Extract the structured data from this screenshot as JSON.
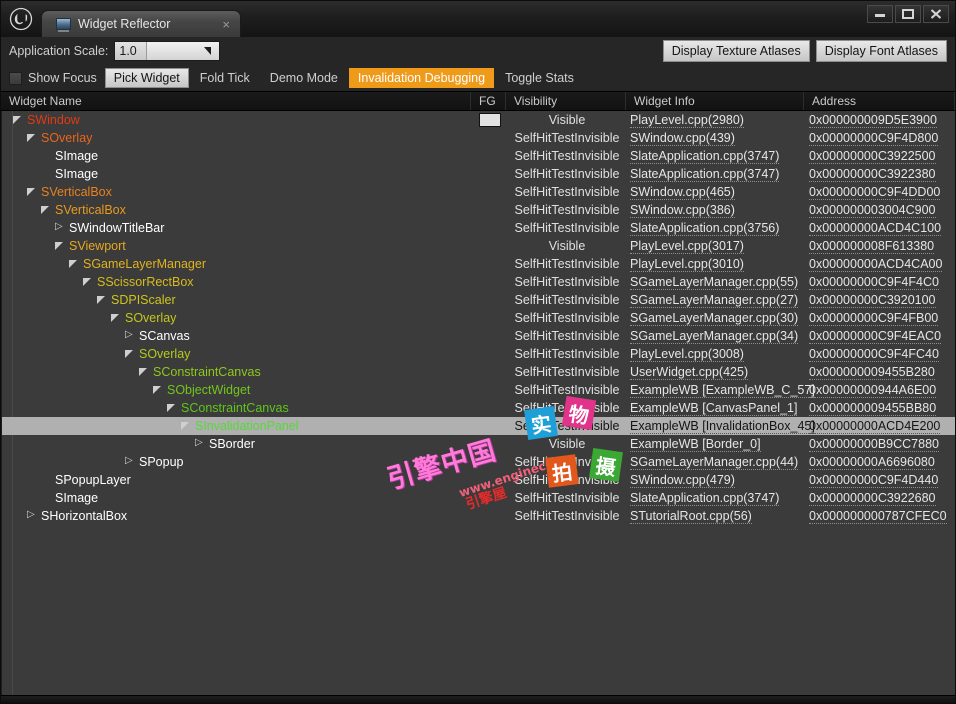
{
  "window": {
    "logo_glyph": "у",
    "controls": {
      "minimize": "minimize-icon",
      "maximize": "maximize-icon",
      "close": "close-icon"
    }
  },
  "tab": {
    "title": "Widget Reflector",
    "close_label": "×"
  },
  "toolbar": {
    "app_scale_label": "Application Scale:",
    "app_scale_value": "1.0",
    "display_texture_atlases": "Display Texture Atlases",
    "display_font_atlases": "Display Font Atlases",
    "show_focus": "Show Focus",
    "pick_widget": "Pick Widget",
    "fold_tick": "Fold Tick",
    "demo_mode": "Demo Mode",
    "invalidation_debugging": "Invalidation Debugging",
    "toggle_stats": "Toggle Stats",
    "accent_orange": "#f09a1a"
  },
  "columns": {
    "widget_name": "Widget Name",
    "fg": "FG",
    "visibility": "Visibility",
    "widget_info": "Widget Info",
    "address": "Address"
  },
  "watermark": {
    "main": "引擎中国",
    "url": "www.enginecn",
    "sub": "引擎屋",
    "stamps": [
      "实",
      "物",
      "拍",
      "摄"
    ]
  },
  "rows": [
    {
      "name": "SWindow",
      "depth": 0,
      "expander": "open",
      "color": "#e03a12",
      "fg": true,
      "visibility": "Visible",
      "info": "PlayLevel.cpp(2980)",
      "address": "0x000000009D5E3900",
      "selected": false
    },
    {
      "name": "SOverlay",
      "depth": 1,
      "expander": "open",
      "color": "#e8651f",
      "fg": false,
      "visibility": "SelfHitTestInvisible",
      "info": "SWindow.cpp(439)",
      "address": "0x00000000C9F4D800",
      "selected": false
    },
    {
      "name": "SImage",
      "depth": 2,
      "expander": "none",
      "color": "#ffffff",
      "fg": false,
      "visibility": "SelfHitTestInvisible",
      "info": "SlateApplication.cpp(3747)",
      "address": "0x00000000C3922500",
      "selected": false
    },
    {
      "name": "SImage",
      "depth": 2,
      "expander": "none",
      "color": "#ffffff",
      "fg": false,
      "visibility": "SelfHitTestInvisible",
      "info": "SlateApplication.cpp(3747)",
      "address": "0x00000000C3922380",
      "selected": false
    },
    {
      "name": "SVerticalBox",
      "depth": 1,
      "expander": "open",
      "color": "#e8821f",
      "fg": false,
      "visibility": "SelfHitTestInvisible",
      "info": "SWindow.cpp(465)",
      "address": "0x00000000C9F4DD00",
      "selected": false
    },
    {
      "name": "SVerticalBox",
      "depth": 2,
      "expander": "open",
      "color": "#e89a1f",
      "fg": false,
      "visibility": "SelfHitTestInvisible",
      "info": "SWindow.cpp(386)",
      "address": "0x000000003004C900",
      "selected": false
    },
    {
      "name": "SWindowTitleBar",
      "depth": 3,
      "expander": "closed",
      "color": "#ffffff",
      "fg": false,
      "visibility": "SelfHitTestInvisible",
      "info": "SlateApplication.cpp(3756)",
      "address": "0x00000000ACD4C100",
      "selected": false
    },
    {
      "name": "SViewport",
      "depth": 3,
      "expander": "open",
      "color": "#e6a81f",
      "fg": false,
      "visibility": "Visible",
      "info": "PlayLevel.cpp(3017)",
      "address": "0x000000008F613380",
      "selected": false
    },
    {
      "name": "SGameLayerManager",
      "depth": 4,
      "expander": "open",
      "color": "#e0b31e",
      "fg": false,
      "visibility": "SelfHitTestInvisible",
      "info": "PlayLevel.cpp(3010)",
      "address": "0x00000000ACD4CA00",
      "selected": false
    },
    {
      "name": "SScissorRectBox",
      "depth": 5,
      "expander": "open",
      "color": "#d8bb1e",
      "fg": false,
      "visibility": "SelfHitTestInvisible",
      "info": "SGameLayerManager.cpp(55)",
      "address": "0x00000000C9F4F4C0",
      "selected": false
    },
    {
      "name": "SDPIScaler",
      "depth": 6,
      "expander": "open",
      "color": "#cfc41d",
      "fg": false,
      "visibility": "SelfHitTestInvisible",
      "info": "SGameLayerManager.cpp(27)",
      "address": "0x00000000C3920100",
      "selected": false
    },
    {
      "name": "SOverlay",
      "depth": 7,
      "expander": "open",
      "color": "#c2c71d",
      "fg": false,
      "visibility": "SelfHitTestInvisible",
      "info": "SGameLayerManager.cpp(30)",
      "address": "0x00000000C9F4FB00",
      "selected": false
    },
    {
      "name": "SCanvas",
      "depth": 8,
      "expander": "closed",
      "color": "#ffffff",
      "fg": false,
      "visibility": "SelfHitTestInvisible",
      "info": "SGameLayerManager.cpp(34)",
      "address": "0x00000000C9F4EAC0",
      "selected": false
    },
    {
      "name": "SOverlay",
      "depth": 8,
      "expander": "open",
      "color": "#b6c91c",
      "fg": false,
      "visibility": "SelfHitTestInvisible",
      "info": "PlayLevel.cpp(3008)",
      "address": "0x00000000C9F4FC40",
      "selected": false
    },
    {
      "name": "SConstraintCanvas",
      "depth": 9,
      "expander": "open",
      "color": "#8ec81c",
      "fg": false,
      "visibility": "SelfHitTestInvisible",
      "info": "UserWidget.cpp(425)",
      "address": "0x000000009455B280",
      "selected": false
    },
    {
      "name": "SObjectWidget",
      "depth": 10,
      "expander": "open",
      "color": "#72c51c",
      "fg": false,
      "visibility": "SelfHitTestInvisible",
      "info": "ExampleWB [ExampleWB_C_57]",
      "address": "0x00000000944A6E00",
      "selected": false
    },
    {
      "name": "SConstraintCanvas",
      "depth": 11,
      "expander": "open",
      "color": "#5ec61c",
      "fg": false,
      "visibility": "SelfHitTestInvisible",
      "info": "ExampleWB [CanvasPanel_1]",
      "address": "0x000000009455BB80",
      "selected": false
    },
    {
      "name": "SInvalidationPanel",
      "depth": 12,
      "expander": "open",
      "color": "#56d83a",
      "fg": false,
      "visibility": "SelfHitTestInvisible",
      "info": "ExampleWB [InvalidationBox_45]",
      "address": "0x00000000ACD4E200",
      "selected": true
    },
    {
      "name": "SBorder",
      "depth": 13,
      "expander": "closed",
      "color": "#ffffff",
      "fg": false,
      "visibility": "Visible",
      "info": "ExampleWB [Border_0]",
      "address": "0x00000000B9CC7880",
      "selected": false
    },
    {
      "name": "SPopup",
      "depth": 8,
      "expander": "closed",
      "color": "#ffffff",
      "fg": false,
      "visibility": "SelfHitTestInvisible",
      "info": "SGameLayerManager.cpp(44)",
      "address": "0x00000000A6696080",
      "selected": false
    },
    {
      "name": "SPopupLayer",
      "depth": 2,
      "expander": "none",
      "color": "#ffffff",
      "fg": false,
      "visibility": "SelfHitTestInvisible",
      "info": "SWindow.cpp(479)",
      "address": "0x00000000C9F4D440",
      "selected": false
    },
    {
      "name": "SImage",
      "depth": 2,
      "expander": "none",
      "color": "#ffffff",
      "fg": false,
      "visibility": "SelfHitTestInvisible",
      "info": "SlateApplication.cpp(3747)",
      "address": "0x00000000C3922680",
      "selected": false
    },
    {
      "name": "SHorizontalBox",
      "depth": 1,
      "expander": "closed",
      "color": "#ffffff",
      "fg": false,
      "visibility": "SelfHitTestInvisible",
      "info": "STutorialRoot.cpp(56)",
      "address": "0x000000000787CFEC0",
      "selected": false
    }
  ]
}
